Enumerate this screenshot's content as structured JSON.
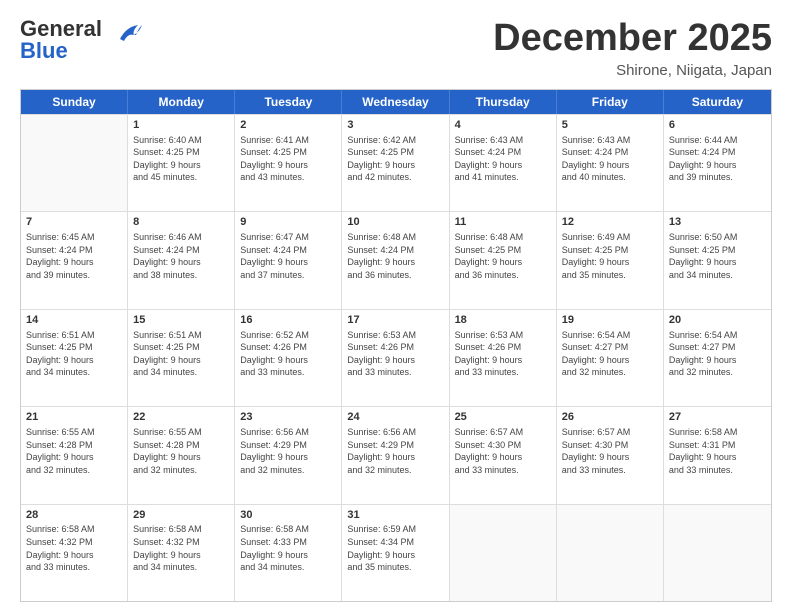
{
  "header": {
    "logo_general": "General",
    "logo_blue": "Blue",
    "month_title": "December 2025",
    "location": "Shirone, Niigata, Japan"
  },
  "weekdays": [
    "Sunday",
    "Monday",
    "Tuesday",
    "Wednesday",
    "Thursday",
    "Friday",
    "Saturday"
  ],
  "rows": [
    [
      {
        "date": "",
        "info": ""
      },
      {
        "date": "1",
        "info": "Sunrise: 6:40 AM\nSunset: 4:25 PM\nDaylight: 9 hours\nand 45 minutes."
      },
      {
        "date": "2",
        "info": "Sunrise: 6:41 AM\nSunset: 4:25 PM\nDaylight: 9 hours\nand 43 minutes."
      },
      {
        "date": "3",
        "info": "Sunrise: 6:42 AM\nSunset: 4:25 PM\nDaylight: 9 hours\nand 42 minutes."
      },
      {
        "date": "4",
        "info": "Sunrise: 6:43 AM\nSunset: 4:24 PM\nDaylight: 9 hours\nand 41 minutes."
      },
      {
        "date": "5",
        "info": "Sunrise: 6:43 AM\nSunset: 4:24 PM\nDaylight: 9 hours\nand 40 minutes."
      },
      {
        "date": "6",
        "info": "Sunrise: 6:44 AM\nSunset: 4:24 PM\nDaylight: 9 hours\nand 39 minutes."
      }
    ],
    [
      {
        "date": "7",
        "info": "Sunrise: 6:45 AM\nSunset: 4:24 PM\nDaylight: 9 hours\nand 39 minutes."
      },
      {
        "date": "8",
        "info": "Sunrise: 6:46 AM\nSunset: 4:24 PM\nDaylight: 9 hours\nand 38 minutes."
      },
      {
        "date": "9",
        "info": "Sunrise: 6:47 AM\nSunset: 4:24 PM\nDaylight: 9 hours\nand 37 minutes."
      },
      {
        "date": "10",
        "info": "Sunrise: 6:48 AM\nSunset: 4:24 PM\nDaylight: 9 hours\nand 36 minutes."
      },
      {
        "date": "11",
        "info": "Sunrise: 6:48 AM\nSunset: 4:25 PM\nDaylight: 9 hours\nand 36 minutes."
      },
      {
        "date": "12",
        "info": "Sunrise: 6:49 AM\nSunset: 4:25 PM\nDaylight: 9 hours\nand 35 minutes."
      },
      {
        "date": "13",
        "info": "Sunrise: 6:50 AM\nSunset: 4:25 PM\nDaylight: 9 hours\nand 34 minutes."
      }
    ],
    [
      {
        "date": "14",
        "info": "Sunrise: 6:51 AM\nSunset: 4:25 PM\nDaylight: 9 hours\nand 34 minutes."
      },
      {
        "date": "15",
        "info": "Sunrise: 6:51 AM\nSunset: 4:25 PM\nDaylight: 9 hours\nand 34 minutes."
      },
      {
        "date": "16",
        "info": "Sunrise: 6:52 AM\nSunset: 4:26 PM\nDaylight: 9 hours\nand 33 minutes."
      },
      {
        "date": "17",
        "info": "Sunrise: 6:53 AM\nSunset: 4:26 PM\nDaylight: 9 hours\nand 33 minutes."
      },
      {
        "date": "18",
        "info": "Sunrise: 6:53 AM\nSunset: 4:26 PM\nDaylight: 9 hours\nand 33 minutes."
      },
      {
        "date": "19",
        "info": "Sunrise: 6:54 AM\nSunset: 4:27 PM\nDaylight: 9 hours\nand 32 minutes."
      },
      {
        "date": "20",
        "info": "Sunrise: 6:54 AM\nSunset: 4:27 PM\nDaylight: 9 hours\nand 32 minutes."
      }
    ],
    [
      {
        "date": "21",
        "info": "Sunrise: 6:55 AM\nSunset: 4:28 PM\nDaylight: 9 hours\nand 32 minutes."
      },
      {
        "date": "22",
        "info": "Sunrise: 6:55 AM\nSunset: 4:28 PM\nDaylight: 9 hours\nand 32 minutes."
      },
      {
        "date": "23",
        "info": "Sunrise: 6:56 AM\nSunset: 4:29 PM\nDaylight: 9 hours\nand 32 minutes."
      },
      {
        "date": "24",
        "info": "Sunrise: 6:56 AM\nSunset: 4:29 PM\nDaylight: 9 hours\nand 32 minutes."
      },
      {
        "date": "25",
        "info": "Sunrise: 6:57 AM\nSunset: 4:30 PM\nDaylight: 9 hours\nand 33 minutes."
      },
      {
        "date": "26",
        "info": "Sunrise: 6:57 AM\nSunset: 4:30 PM\nDaylight: 9 hours\nand 33 minutes."
      },
      {
        "date": "27",
        "info": "Sunrise: 6:58 AM\nSunset: 4:31 PM\nDaylight: 9 hours\nand 33 minutes."
      }
    ],
    [
      {
        "date": "28",
        "info": "Sunrise: 6:58 AM\nSunset: 4:32 PM\nDaylight: 9 hours\nand 33 minutes."
      },
      {
        "date": "29",
        "info": "Sunrise: 6:58 AM\nSunset: 4:32 PM\nDaylight: 9 hours\nand 34 minutes."
      },
      {
        "date": "30",
        "info": "Sunrise: 6:58 AM\nSunset: 4:33 PM\nDaylight: 9 hours\nand 34 minutes."
      },
      {
        "date": "31",
        "info": "Sunrise: 6:59 AM\nSunset: 4:34 PM\nDaylight: 9 hours\nand 35 minutes."
      },
      {
        "date": "",
        "info": ""
      },
      {
        "date": "",
        "info": ""
      },
      {
        "date": "",
        "info": ""
      }
    ]
  ]
}
